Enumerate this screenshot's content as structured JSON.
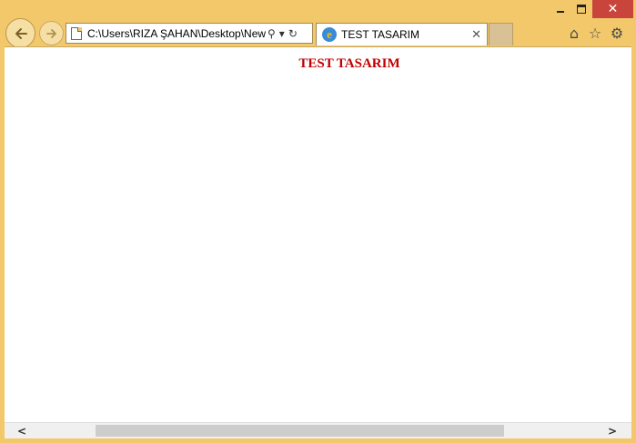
{
  "window": {
    "controls": {
      "minimize": "minimize-icon",
      "maximize": "maximize-icon",
      "close_glyph": "✕"
    }
  },
  "navigation": {
    "back_glyph": "←",
    "forward_glyph": "→",
    "address": "C:\\Users\\RIZA ŞAHAN\\Desktop\\New Te",
    "search_glyph": "⚲",
    "dropdown_glyph": "▾",
    "refresh_glyph": "↻"
  },
  "tab": {
    "favicon_letter": "e",
    "title": "TEST TASARIM",
    "close_glyph": "✕"
  },
  "toolbar": {
    "home_glyph": "⌂",
    "favorites_glyph": "☆",
    "tools_glyph": "⚙"
  },
  "page": {
    "heading": "TEST TASARIM"
  },
  "scrollbar": {
    "left_glyph": "<",
    "right_glyph": ">"
  },
  "colors": {
    "frame": "#f2c86a",
    "close_button": "#c9443b",
    "heading": "#c00000"
  }
}
